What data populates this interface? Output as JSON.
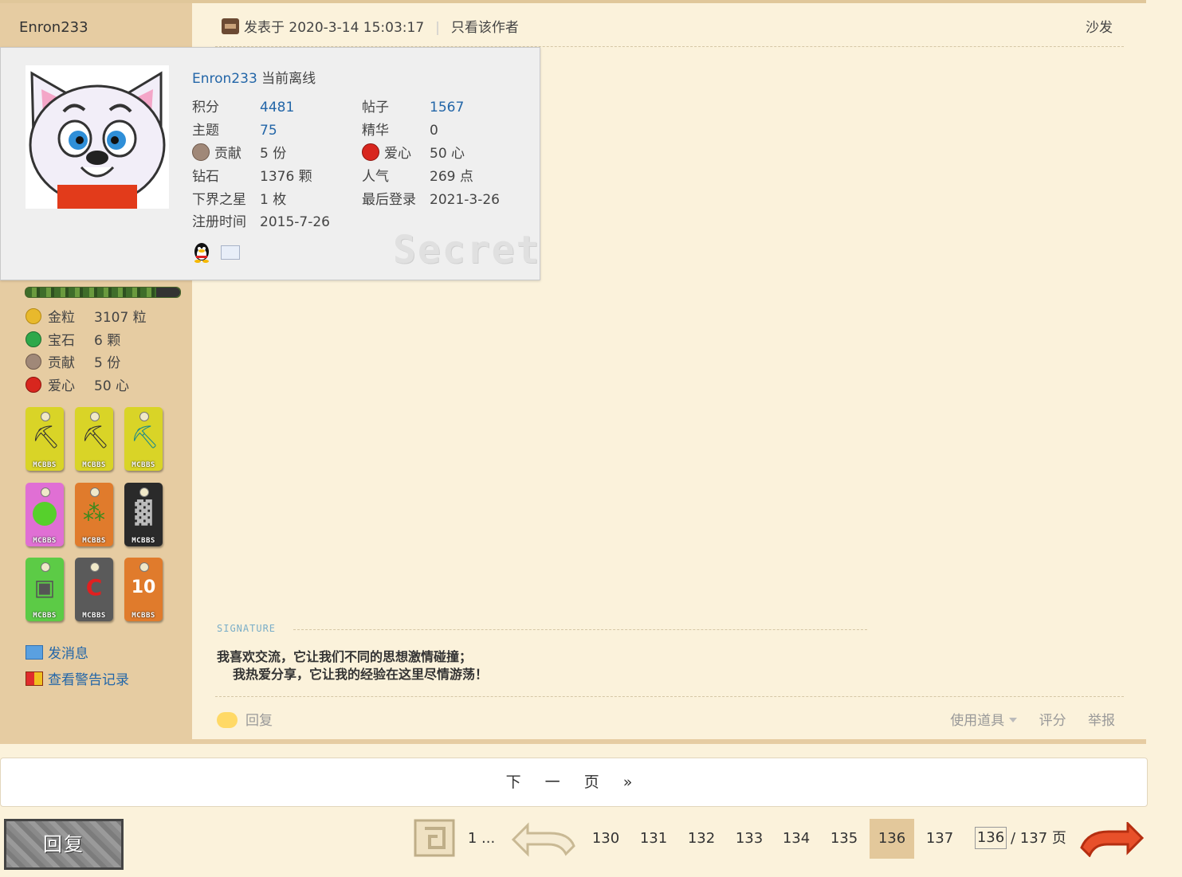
{
  "author": {
    "name": "Enron233"
  },
  "post": {
    "posted_label": "发表于 2020-3-14 15:03:17",
    "only_author": "只看该作者",
    "floor": "沙发"
  },
  "card": {
    "name": "Enron233",
    "status": "当前离线",
    "rows_left": [
      {
        "k": "积分",
        "v": "4481",
        "link": true
      },
      {
        "k": "主题",
        "v": "75",
        "link": true
      },
      {
        "k": "贡献",
        "v": "5 份",
        "icon": "contribution-icon"
      },
      {
        "k": "钻石",
        "v": "1376 颗"
      },
      {
        "k": "下界之星",
        "v": "1 枚"
      },
      {
        "k": "注册时间",
        "v": "2015-7-26"
      }
    ],
    "rows_right": [
      {
        "k": "帖子",
        "v": "1567",
        "link": true
      },
      {
        "k": "精华",
        "v": "0"
      },
      {
        "k": "爱心",
        "v": "50 心",
        "icon": "heart-icon"
      },
      {
        "k": "人气",
        "v": "269 点"
      },
      {
        "k": "最后登录",
        "v": "2021-3-26"
      }
    ],
    "watermark": "Secret"
  },
  "left_stats": [
    {
      "label": "金粒",
      "value": "3107 粒",
      "icon": "gold-nugget-icon",
      "color": "#e8b92c"
    },
    {
      "label": "宝石",
      "value": "6 颗",
      "icon": "emerald-icon",
      "color": "#2ea84a"
    },
    {
      "label": "贡献",
      "value": "5 份",
      "icon": "contribution-icon",
      "color": "#a08878"
    },
    {
      "label": "爱心",
      "value": "50 心",
      "icon": "heart-icon",
      "color": "#d8261e"
    }
  ],
  "medals": [
    {
      "name": "pickaxe-medal-1",
      "color": "#d9d427",
      "glyph": "⛏",
      "tag": "MCBBS"
    },
    {
      "name": "pickaxe-medal-2",
      "color": "#d9d427",
      "glyph": "⛏",
      "tag": "MCBBS"
    },
    {
      "name": "pickaxe-medal-3",
      "color": "#d9d427",
      "glyph": "⛏",
      "tag": "MCBBS"
    },
    {
      "name": "apple-medal",
      "color": "#e06fd4",
      "glyph": "🍏",
      "tag": "MCBBS"
    },
    {
      "name": "seeds-medal",
      "color": "#e07b2c",
      "glyph": "⁂",
      "tag": "MCBBS"
    },
    {
      "name": "ore-medal",
      "color": "#2a2a2a",
      "glyph": "▓",
      "tag": "MCBBS"
    },
    {
      "name": "minecart-medal",
      "color": "#5ccb46",
      "glyph": "▣",
      "tag": "MCBBS"
    },
    {
      "name": "c-block-medal",
      "color": "#5a5a5a",
      "glyph": "C",
      "tag": "MCBBS"
    },
    {
      "name": "ten-medal",
      "color": "#e07b2c",
      "glyph": "10",
      "tag": "MCBBS"
    }
  ],
  "left_links": {
    "message": "发消息",
    "warnings": "查看警告记录"
  },
  "signature": {
    "label": "SIGNATURE",
    "line1": "我喜欢交流，它让我们不同的思想激情碰撞；",
    "line2": "我热爱分享，它让我的经验在这里尽情游荡！"
  },
  "reply_row": {
    "reply": "回复",
    "use_item": "使用道具",
    "rate": "评分",
    "report": "举报"
  },
  "next_page": "下 一 页 »",
  "reply_button": "回复",
  "pager": {
    "first": "1 ...",
    "pages": [
      "130",
      "131",
      "132",
      "133",
      "134",
      "135",
      "136",
      "137"
    ],
    "current": "136",
    "input_value": "136",
    "total": "/ 137 页"
  },
  "colors": {
    "link": "#2366a8",
    "sidebar": "#e6cca2",
    "background": "#fbf2db",
    "current_page": "#e3c89b"
  }
}
